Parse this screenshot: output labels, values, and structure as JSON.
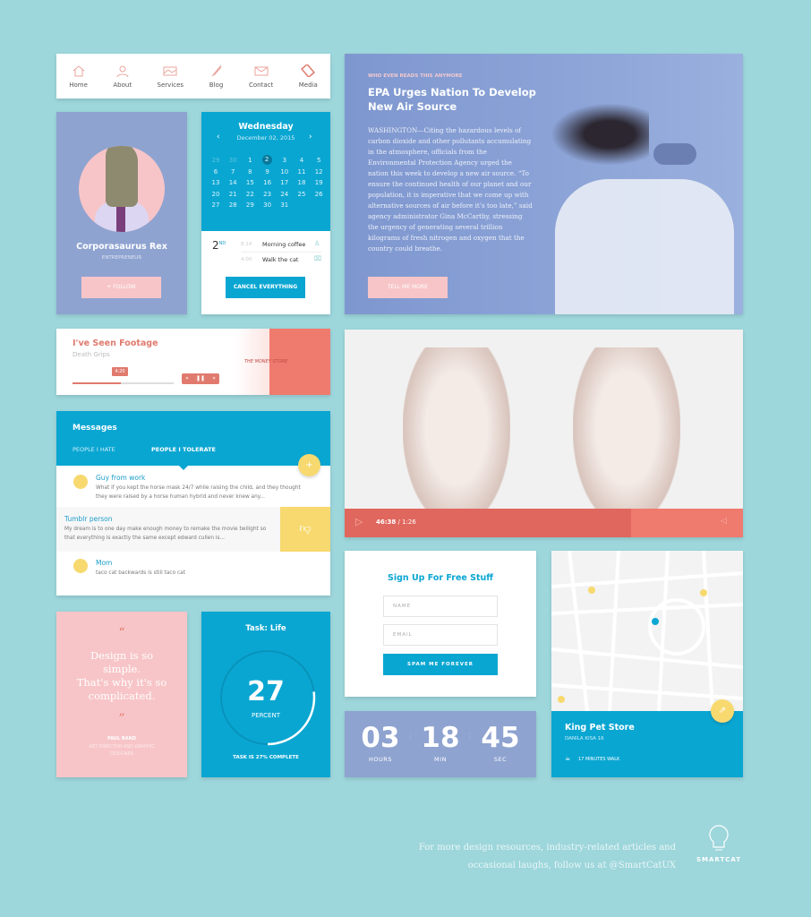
{
  "colors": {
    "background": "#9dd6db",
    "blue": "#0aa6d2",
    "purple": "#8fa3d0",
    "pink": "#f7c5c8",
    "coral": "#ef7a6e",
    "yellow": "#f7d96f"
  },
  "nav": {
    "items": [
      {
        "label": "Home",
        "icon": "home-icon"
      },
      {
        "label": "About",
        "icon": "user-icon"
      },
      {
        "label": "Services",
        "icon": "image-icon"
      },
      {
        "label": "Blog",
        "icon": "pen-icon"
      },
      {
        "label": "Contact",
        "icon": "mail-icon"
      },
      {
        "label": "Media",
        "icon": "film-icon"
      }
    ]
  },
  "profile": {
    "name": "Corporasaurus Rex",
    "role": "ENTREPRENEUR",
    "follow_label": "+ FOLLOW"
  },
  "calendar": {
    "weekday": "Wednesday",
    "date": "December 02, 2015",
    "selected": "2",
    "days": [
      "29",
      "30",
      "1",
      "2",
      "3",
      "4",
      "5",
      "6",
      "7",
      "8",
      "9",
      "10",
      "11",
      "12",
      "13",
      "14",
      "15",
      "16",
      "17",
      "18",
      "19",
      "20",
      "21",
      "22",
      "23",
      "24",
      "25",
      "26",
      "27",
      "28",
      "29",
      "30",
      "31"
    ],
    "event_day": "2",
    "event_suffix": "ND",
    "events": [
      {
        "time": "8:14",
        "title": "Morning coffee"
      },
      {
        "time": "4:00",
        "title": "Walk the cat"
      }
    ],
    "cancel_label": "CANCEL EVERYTHING"
  },
  "article": {
    "kicker": "WHO EVEN READS THIS ANYMORE",
    "title_line1": "EPA Urges Nation To Develop",
    "title_line2": "New Air Source",
    "body": "WASHINGTON—Citing the hazardous levels of carbon dioxide and other pollutants accumulating in the atmosphere, officials from the Environmental Protection Agency urged the nation this week to develop a new air source. “To ensure the continued health of our planet and our population, it is imperative that we come up with alternative sources of air before it’s too late,” said agency administrator Gina McCarthy, stressing the urgency of generating several trillion kilograms of fresh nitrogen and oxygen that the country could breathe.",
    "button_label": "TELL ME MORE"
  },
  "player": {
    "title": "I've Seen Footage",
    "artist": "Death Grips",
    "time_tooltip": "4:20",
    "progress": 0.48,
    "album_text": "THE MONEY STORE"
  },
  "video": {
    "current": "46:38",
    "separator": "/",
    "duration": "1:26",
    "progress": 0.72
  },
  "messages": {
    "title": "Messages",
    "tabs": [
      "PEOPLE I HATE",
      "PEOPLE I TOLERATE"
    ],
    "active_tab": 1,
    "items": [
      {
        "name": "Guy from work",
        "text": "What if you kept the horse mask 24/7 while raising the child, and they thought they were raised by a horse human hybrid and never knew any..."
      },
      {
        "name": "Tumblr person",
        "text": "My dream is to one day make enough money to remake the movie twilight so that everything is exactly the same except edward cullen is..."
      },
      {
        "name": "Mom",
        "text": "taco cat backwards is still taco cat"
      }
    ]
  },
  "quote": {
    "open": "“",
    "text_lines": [
      "Design is so",
      "simple.",
      "That's why it's so",
      "complicated."
    ],
    "close": "”",
    "author": "PAUL RAND",
    "author_title_lines": [
      "ART DIRECTOR AND GRAPHIC",
      "DESIGNER"
    ]
  },
  "task": {
    "title": "Task: Life",
    "value": "27",
    "unit": "PERCENT",
    "progress": 0.27,
    "caption": "TASK IS 27% COMPLETE"
  },
  "signup": {
    "title": "Sign Up For Free Stuff",
    "name_placeholder": "NAME",
    "email_placeholder": "EMAIL",
    "button_label": "SPAM ME FOREVER"
  },
  "countdown": {
    "hours": "03",
    "minutes": "18",
    "seconds": "45",
    "hours_label": "HOURS",
    "minutes_label": "MIN",
    "seconds_label": "SEC"
  },
  "map": {
    "place": "King Pet Store",
    "address": "DANILA KISA 16",
    "walk": "17 MINUTES WALK"
  },
  "footer": {
    "line1": "For more design resources, industry-related articles and",
    "line2": "occasional laughs, follow us at @SmartCatUX",
    "logo_text": "SMARTCAT"
  }
}
